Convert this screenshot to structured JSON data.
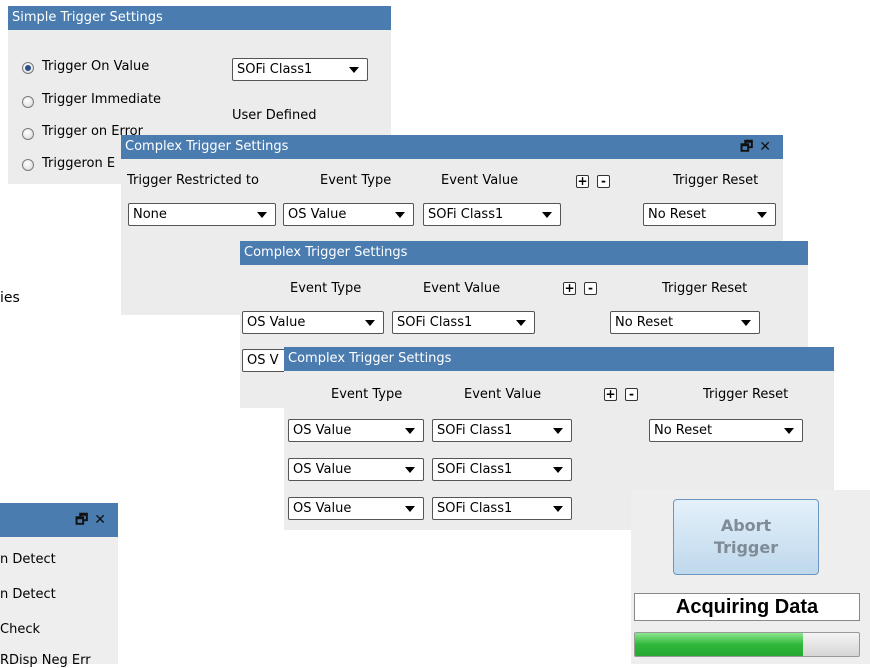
{
  "simple": {
    "title": "Simple Trigger Settings",
    "options": [
      "Trigger On Value",
      "Trigger Immediate",
      "Trigger on Error",
      "Triggeron E"
    ],
    "selected_index": 0,
    "class_select": "SOFi Class1",
    "user_defined": "User Defined"
  },
  "bg_text": {
    "ies": "ies"
  },
  "complex1": {
    "title": "Complex Trigger Settings",
    "h_restricted": "Trigger Restricted to",
    "h_event_type": "Event Type",
    "h_event_value": "Event Value",
    "h_reset": "Trigger Reset",
    "plus": "+",
    "minus": "-",
    "row": {
      "restricted": "None",
      "event_type": "OS Value",
      "event_value": "SOFi Class1",
      "reset": "No Reset"
    }
  },
  "complex2": {
    "title": "Complex Trigger Settings",
    "h_event_type": "Event Type",
    "h_event_value": "Event Value",
    "h_reset": "Trigger Reset",
    "plus": "+",
    "minus": "-",
    "row": {
      "event_type": "OS Value",
      "event_value": "SOFi Class1",
      "reset": "No Reset"
    },
    "row2_partial": "OS V"
  },
  "complex3": {
    "title": "Complex Trigger Settings",
    "h_event_type": "Event Type",
    "h_event_value": "Event Value",
    "h_reset": "Trigger Reset",
    "plus": "+",
    "minus": "-",
    "rows": [
      {
        "event_type": "OS Value",
        "event_value": "SOFi Class1"
      },
      {
        "event_type": "OS Value",
        "event_value": "SOFi Class1"
      },
      {
        "event_type": "OS Value",
        "event_value": "SOFi Class1"
      }
    ],
    "reset": "No Reset"
  },
  "bottom_left": {
    "items": [
      "n Detect",
      "n Detect",
      "Check",
      "RDisp Neg Err"
    ]
  },
  "abort": {
    "line1": "Abort",
    "line2": "Trigger",
    "status": "Acquiring Data",
    "progress": 0.75
  },
  "colors": {
    "titlebar": "#4a7cb0",
    "panel": "#ececec",
    "progress": "#3cc84a"
  }
}
